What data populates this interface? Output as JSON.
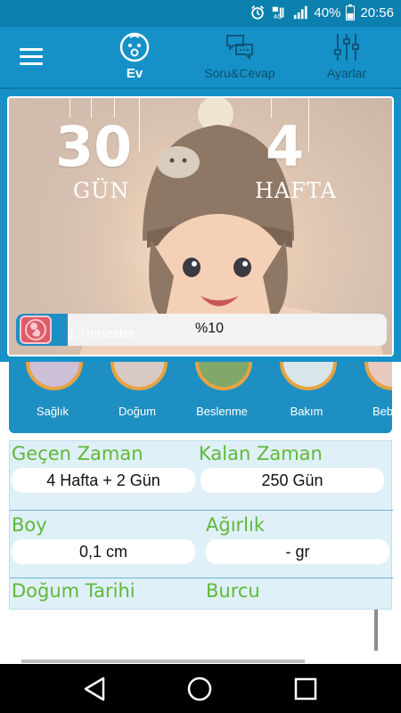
{
  "status_bar": {
    "battery": "40%",
    "time": "20:56"
  },
  "header": {
    "menu_icon": "hamburger-icon",
    "tabs": [
      {
        "label": "Ev",
        "icon": "baby-face-icon",
        "active": true
      },
      {
        "label": "Soru&Cevap",
        "icon": "chat-bubbles-icon",
        "active": false
      },
      {
        "label": "Ayarlar",
        "icon": "sliders-icon",
        "active": false
      }
    ]
  },
  "hero": {
    "days_value": "30",
    "days_unit": "GÜN",
    "weeks_value": "4",
    "weeks_unit": "HAFTA",
    "trimester": "1.Trimester",
    "progress_text": "%10",
    "progress_fraction": 0.14
  },
  "categories": [
    {
      "label": "Sağlık"
    },
    {
      "label": "Doğum"
    },
    {
      "label": "Beslenme"
    },
    {
      "label": "Bakım"
    },
    {
      "label": "Bebek"
    }
  ],
  "info": {
    "elapsed_label": "Geçen Zaman",
    "elapsed_value": "4 Hafta + 2 Gün",
    "remaining_label": "Kalan Zaman",
    "remaining_value": "250 Gün",
    "height_label": "Boy",
    "height_value": "0,1 cm",
    "weight_label": "Ağırlık",
    "weight_value": "- gr",
    "birth_date_label": "Doğum Tarihi",
    "zodiac_label": "Burcu"
  },
  "colors": {
    "primary": "#1691c7",
    "status_bar": "#0b7fae",
    "label_green": "#5fb83a",
    "ring_orange": "#e6a343",
    "panel_bg": "#dff0f8"
  }
}
